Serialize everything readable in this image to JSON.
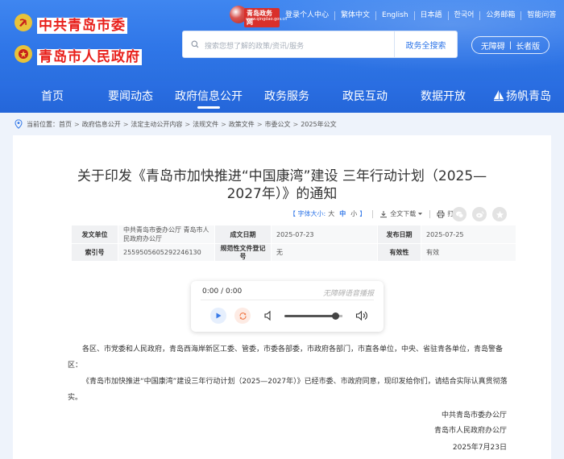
{
  "header": {
    "org_party": "中共青岛市委",
    "org_gov": "青岛市人民政府",
    "logo_text": "青岛政务网",
    "logo_sub": "www.qingdao.gov.cn",
    "toplinks": [
      "登录个人中心",
      "繁体中文",
      "English",
      "日本語",
      "한국어",
      "公务邮箱",
      "智能问答"
    ],
    "search_placeholder": "搜索您想了解的政策/资讯/服务",
    "search_button": "政务全搜索",
    "a11y_left": "无障碍",
    "a11y_sep": "|",
    "a11y_right": "长者版"
  },
  "nav": {
    "items": [
      "首页",
      "要闻动态",
      "政府信息公开",
      "政务服务",
      "政民互动",
      "数据开放",
      "扬帆青岛"
    ],
    "active_index": 2
  },
  "breadcrumb": {
    "prefix": "当前位置：",
    "items": [
      "首页",
      "政府信息公开",
      "法定主动公开内容",
      "法规文件",
      "政策文件",
      "市委公文",
      "2025年公文"
    ],
    "separator": ">"
  },
  "article": {
    "title": "关于印发《青岛市加快推进“中国康湾”建设 三年行动计划（2025—2027年）》的通知",
    "font_size_label": "【 字体大小:",
    "size_large": "大",
    "size_medium": "中",
    "size_small": "小",
    "font_size_end": "】",
    "download": "全文下载",
    "print": "打印",
    "meta": {
      "issuer_label": "发文单位",
      "issuer": "中共青岛市委办公厅 青岛市人民政府办公厅",
      "date_label": "成文日期",
      "date": "2025-07-23",
      "publish_label": "发布日期",
      "publish": "2025-07-25",
      "index_label": "索引号",
      "index": "2559505605292246130",
      "reg_label": "规范性文件登记号",
      "reg": "无",
      "valid_label": "有效性",
      "valid": "有效"
    },
    "player": {
      "time": "0:00 / 0:00",
      "hint": "无障碍语音播报",
      "volume": 0.88
    },
    "para1": "各区、市党委和人民政府，青岛西海岸新区工委、管委，市委各部委，市政府各部门，市直各单位，中央、省驻青各单位，青岛警备区：",
    "para2": "《青岛市加快推进“中国康湾”建设三年行动计划（2025—2027年）》已经市委、市政府同意，现印发给你们，请结合实际认真贯彻落实。",
    "sign1": "中共青岛市委办公厅",
    "sign2": "青岛市人民政府办公厅",
    "sign_date": "2025年7月23日"
  },
  "colors": {
    "primary": "#2f76e8",
    "org_red": "#e8201b",
    "emblem_gold": "#e8c23a"
  }
}
